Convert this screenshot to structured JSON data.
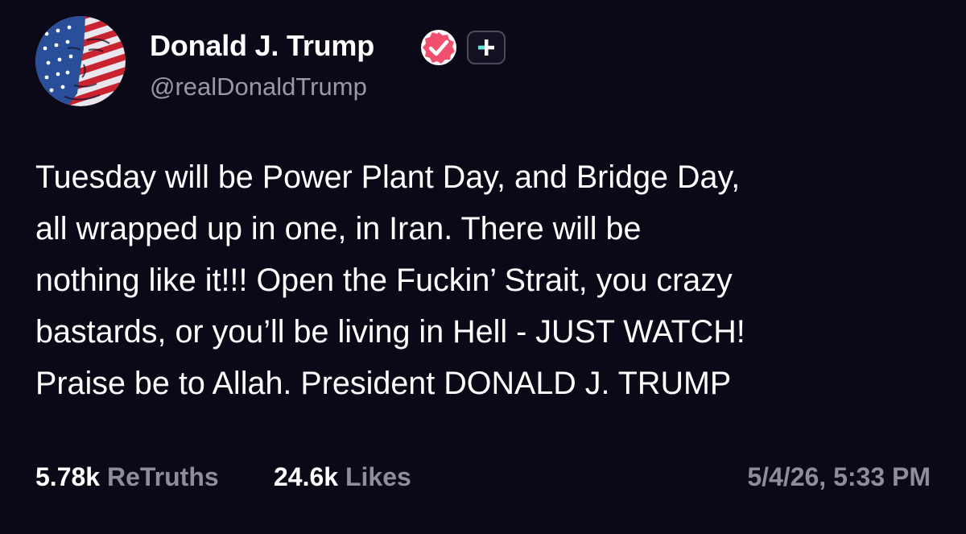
{
  "profile": {
    "display_name": "Donald J. Trump",
    "handle": "@realDonaldTrump",
    "avatar_icon": "flag-portrait-avatar",
    "verified_icon": "verified-badge-icon",
    "plus_icon": "plus-badge-icon"
  },
  "post": {
    "lines": [
      "Tuesday will be Power Plant Day, and Bridge Day,",
      "all wrapped up in one, in Iran. There will be",
      "nothing like it!!! Open the Fuckin’ Strait, you crazy",
      "bastards, or you’ll be living in Hell - JUST WATCH!",
      "Praise be to Allah. President DONALD J. TRUMP"
    ]
  },
  "stats": {
    "retruths_count": "5.78k",
    "retruths_label": "ReTruths",
    "likes_count": "24.6k",
    "likes_label": "Likes"
  },
  "timestamp": "5/4/26, 5:33 PM",
  "colors": {
    "background": "#0b0818",
    "text_primary": "#ffffff",
    "text_secondary": "#9a97a6",
    "verified_badge": "#f0506e",
    "plus_accent": "#5ee8d8"
  }
}
